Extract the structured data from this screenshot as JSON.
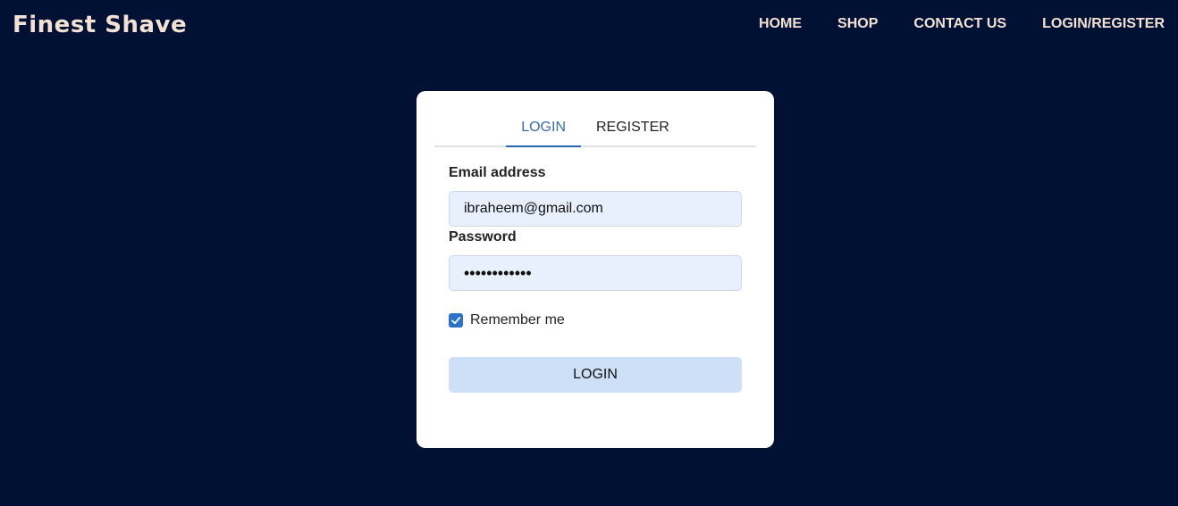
{
  "navbar": {
    "brand": "Finest Shave",
    "links": [
      "HOME",
      "SHOP",
      "CONTACT US",
      "LOGIN/REGISTER"
    ]
  },
  "auth_card": {
    "tabs": [
      {
        "label": "LOGIN",
        "active": true
      },
      {
        "label": "REGISTER",
        "active": false
      }
    ],
    "email": {
      "label": "Email address",
      "value": "ibraheem@gmail.com"
    },
    "password": {
      "label": "Password",
      "masked_value": "••••••••••••"
    },
    "remember": {
      "label": "Remember me",
      "checked": true
    },
    "submit_label": "LOGIN"
  },
  "colors": {
    "background": "#001133",
    "nav_text": "#f3e2d3",
    "active_tab": "#2a64a9",
    "input_bg": "#e8f0fd",
    "button_bg": "#cde0f7",
    "checkbox": "#2a72c8"
  },
  "icons": {
    "checkbox": "checkmark-icon"
  }
}
